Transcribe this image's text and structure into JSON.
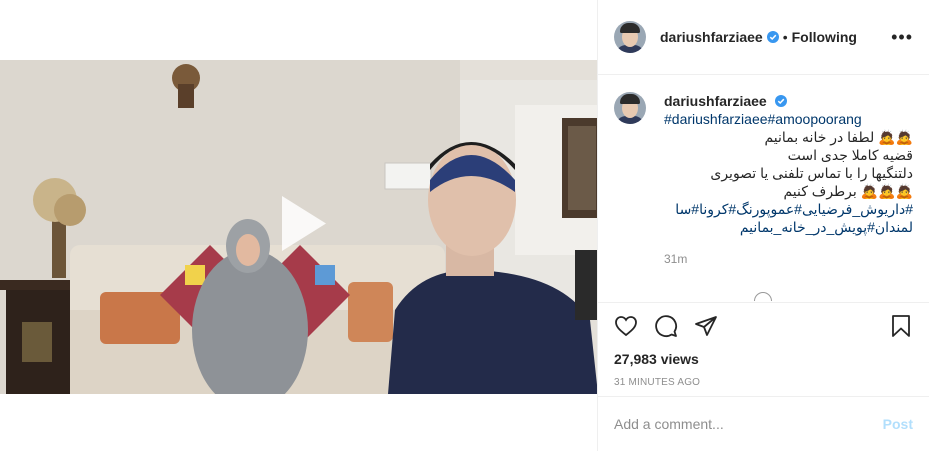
{
  "header": {
    "username": "dariushfarziaee",
    "separator": "•",
    "follow_status": "Following",
    "more_label": "•••"
  },
  "caption": {
    "username": "dariushfarziaee",
    "hashtags_line": "#dariushfarziaee#amoopoorang",
    "line1": "🙇🙇 لطفا در خانه بمانیم",
    "line2": "قضیه کاملا جدی است",
    "line3": "دلتنگیها را با تماس تلفنی یا تصویری",
    "line4": "🙇🙇🙇 برطرف کنیم",
    "tags_line1": "#داریوش_فرضیایی#عموپورنگ#کرونا#سا",
    "tags_line2": "لمندان#پویش_در_خانه_بمانیم",
    "time": "31m"
  },
  "stats": {
    "views": "27,983 views",
    "posted": "31 MINUTES AGO"
  },
  "comment": {
    "placeholder": "Add a comment...",
    "post_label": "Post"
  },
  "colors": {
    "accent_link": "#00376b",
    "verified": "#3897f0",
    "post_button_disabled": "#b2dffc",
    "muted": "#8e8e8e"
  },
  "icons": {
    "verified": "verified-badge-icon",
    "like": "heart-icon",
    "comment": "comment-icon",
    "share": "paper-plane-icon",
    "save": "bookmark-icon",
    "play": "play-icon",
    "more": "more-options-icon"
  }
}
